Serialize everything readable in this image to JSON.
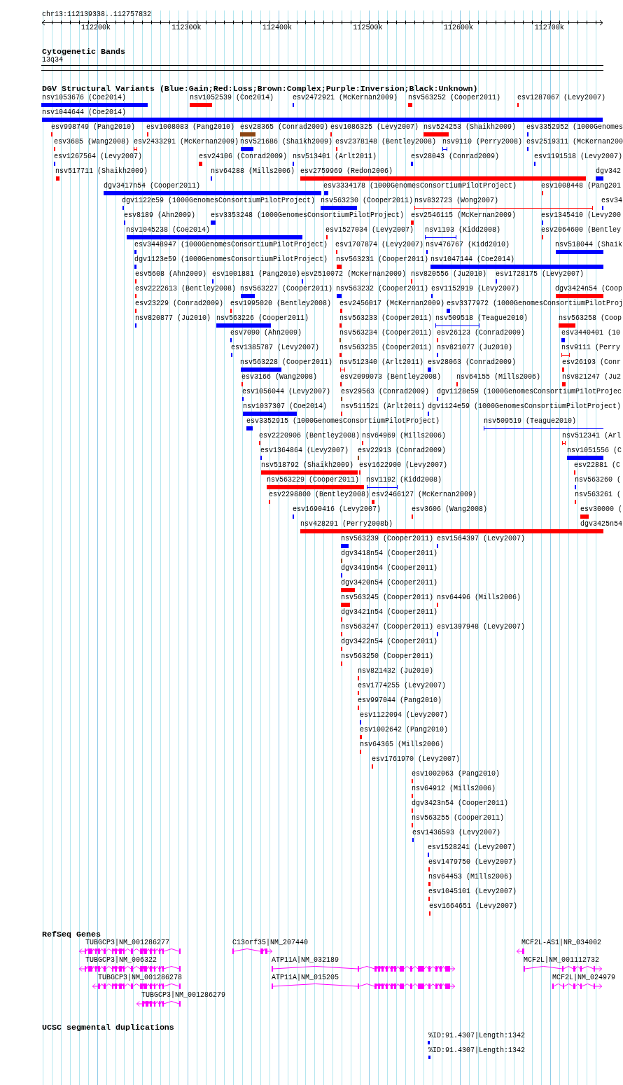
{
  "locus": "chr13:112139338..112757832",
  "ruler": {
    "ticks": [
      "112200k",
      "112300k",
      "112400k",
      "112500k",
      "112600k",
      "112700k"
    ]
  },
  "cytogenetic_bands": {
    "title": "Cytogenetic Bands",
    "bands": [
      {
        "label": "13q34"
      }
    ]
  },
  "dgv_variants": {
    "title": "DGV Structural Variants (Blue:Gain;Red:Loss;Brown:Complex;Purple:Inversion;Black:Unknown)",
    "rows": [
      {
        "features": [
          {
            "label": "nsv1053676 (Coe2014)",
            "kind": "bar",
            "color": "#0000ff"
          },
          {
            "label": "nsv1052539 (Coe2014)",
            "kind": "bar",
            "color": "#ff0000"
          },
          {
            "label": "esv2472921 (McKernan2009)",
            "kind": "bar",
            "color": "#0000ff"
          },
          {
            "label": "nsv563252 (Cooper2011)",
            "kind": "bar",
            "color": "#ff0000"
          },
          {
            "label": "esv1287067 (Levy2007)",
            "kind": "bar",
            "color": "#ff0000"
          }
        ]
      },
      {
        "features": [
          {
            "label": "nsv1044644 (Coe2014)",
            "kind": "bar",
            "color": "#0000ff"
          }
        ]
      },
      {
        "features": [
          {
            "label": "esv998749 (Pang2010)",
            "kind": "bar",
            "color": "#ff0000"
          },
          {
            "label": "esv1008083 (Pang2010)",
            "kind": "bar",
            "color": "#ff0000"
          },
          {
            "label": "esv28365 (Conrad2009)",
            "kind": "bar",
            "color": "#8b4513"
          },
          {
            "label": "esv1086325 (Levy2007)",
            "kind": "bar",
            "color": "#ff0000"
          },
          {
            "label": "nsv524253 (Shaikh2009)",
            "kind": "bar",
            "color": "#ff0000"
          },
          {
            "label": "esv3352952 (1000Genomes",
            "kind": "bar",
            "color": "#0000ff"
          }
        ]
      },
      {
        "features": [
          {
            "label": "esv3685 (Wang2008)",
            "kind": "bar",
            "color": "#ff0000"
          },
          {
            "label": "esv2433291 (McKernan2009)",
            "kind": "span",
            "color": "#ff0000"
          },
          {
            "label": "nsv521686 (Shaikh2009)",
            "kind": "bar",
            "color": "#0000ff"
          },
          {
            "label": "esv2378148 (Bentley2008)",
            "kind": "bar",
            "color": "#ff0000"
          },
          {
            "label": "nsv9110 (Perry2008)",
            "kind": "span",
            "color": "#0000ff"
          },
          {
            "label": "esv2519311 (McKernan200",
            "kind": "bar",
            "color": "#0000ff"
          }
        ]
      },
      {
        "features": [
          {
            "label": "esv1267564 (Levy2007)",
            "kind": "bar",
            "color": "#0000ff"
          },
          {
            "label": "esv24106 (Conrad2009)",
            "kind": "bar",
            "color": "#ff0000"
          },
          {
            "label": "nsv513401 (Arlt2011)",
            "kind": "bar",
            "color": "#0000ff"
          },
          {
            "label": "esv28043 (Conrad2009)",
            "kind": "bar",
            "color": "#0000ff"
          },
          {
            "label": "esv1191518 (Levy2007)",
            "kind": "bar",
            "color": "#0000ff"
          }
        ]
      },
      {
        "features": [
          {
            "label": "nsv517711 (Shaikh2009)",
            "kind": "bar",
            "color": "#ff0000"
          },
          {
            "label": "nsv64288 (Mills2006)",
            "kind": "bar",
            "color": "#0000ff"
          },
          {
            "label": "esv2759969 (Redon2006)",
            "kind": "bar",
            "color": "#ff0000"
          },
          {
            "label": "dgv342",
            "kind": "bar",
            "color": "#0000ff"
          }
        ]
      },
      {
        "features": [
          {
            "label": "dgv3417n54 (Cooper2011)",
            "kind": "bar",
            "color": "#0000ff"
          },
          {
            "label": "esv3334178 (1000GenomesConsortiumPilotProject)",
            "kind": "bar",
            "color": "#0000ff"
          },
          {
            "label": "esv1008448 (Pang201",
            "kind": "bar",
            "color": "#ff0000"
          }
        ]
      },
      {
        "features": [
          {
            "label": "dgv1122e59 (1000GenomesConsortiumPilotProject)",
            "kind": "bar",
            "color": "#0000ff"
          },
          {
            "label": "nsv563230 (Cooper2011)",
            "kind": "bar",
            "color": "#0000ff"
          },
          {
            "label": "nsv832723 (Wong2007)",
            "kind": "span",
            "color": "#ff0000"
          },
          {
            "label": "esv34",
            "kind": "bar",
            "color": "#0000ff"
          }
        ]
      },
      {
        "features": [
          {
            "label": "esv8189 (Ahn2009)",
            "kind": "bar",
            "color": "#0000ff"
          },
          {
            "label": "esv3353248 (1000GenomesConsortiumPilotProject)",
            "kind": "bar",
            "color": "#0000ff"
          },
          {
            "label": "esv2546115 (McKernan2009)",
            "kind": "bar",
            "color": "#ff0000"
          },
          {
            "label": "esv1345410 (Levy200",
            "kind": "bar",
            "color": "#0000ff"
          }
        ]
      },
      {
        "features": [
          {
            "label": "nsv1045238 (Coe2014)",
            "kind": "bar",
            "color": "#0000ff"
          },
          {
            "label": "esv1527034 (Levy2007)",
            "kind": "bar",
            "color": "#ff0000"
          },
          {
            "label": "nsv1193 (Kidd2008)",
            "kind": "span",
            "color": "#0000ff"
          },
          {
            "label": "esv2064600 (Bentley",
            "kind": "bar",
            "color": "#ff0000"
          }
        ]
      },
      {
        "features": [
          {
            "label": "esv3448947 (1000GenomesConsortiumPilotProject)",
            "kind": "bar",
            "color": "#0000ff"
          },
          {
            "label": "esv1707874 (Levy2007)",
            "kind": "bar",
            "color": "#ff0000"
          },
          {
            "label": "nsv476767 (Kidd2010)",
            "kind": "bar",
            "color": "#0000ff"
          },
          {
            "label": "nsv518044 (Shaik",
            "kind": "bar",
            "color": "#0000ff"
          }
        ]
      },
      {
        "features": [
          {
            "label": "dgv1123e59 (1000GenomesConsortiumPilotProject)",
            "kind": "bar",
            "color": "#0000ff"
          },
          {
            "label": "nsv563231 (Cooper2011)",
            "kind": "bar",
            "color": "#ff0000"
          },
          {
            "label": "nsv1047144 (Coe2014)",
            "kind": "bar",
            "color": "#0000ff"
          }
        ]
      },
      {
        "features": [
          {
            "label": "esv5608 (Ahn2009)",
            "kind": "bar",
            "color": "#ff0000"
          },
          {
            "label": "esv1001881 (Pang2010)",
            "kind": "bar",
            "color": "#0000ff"
          },
          {
            "label": "esv2510072 (McKernan2009)",
            "kind": "bar",
            "color": "#0000ff"
          },
          {
            "label": "nsv820556 (Ju2010)",
            "kind": "bar",
            "color": "#ff0000"
          },
          {
            "label": "esv1728175 (Levy2007)",
            "kind": "bar",
            "color": "#0000ff"
          }
        ]
      },
      {
        "features": [
          {
            "label": "esv2222613 (Bentley2008)",
            "kind": "bar",
            "color": "#ff0000"
          },
          {
            "label": "nsv563227 (Cooper2011)",
            "kind": "bar",
            "color": "#0000ff"
          },
          {
            "label": "nsv563232 (Cooper2011)",
            "kind": "bar",
            "color": "#0000ff"
          },
          {
            "label": "esv1152919 (Levy2007)",
            "kind": "bar",
            "color": "#0000ff"
          },
          {
            "label": "dgv3424n54 (Coop",
            "kind": "bar",
            "color": "#ff0000"
          }
        ]
      },
      {
        "features": [
          {
            "label": "esv23229 (Conrad2009)",
            "kind": "bar",
            "color": "#ff0000"
          },
          {
            "label": "esv1995020 (Bentley2008)",
            "kind": "bar",
            "color": "#ff0000"
          },
          {
            "label": "esv2456017 (McKernan2009)",
            "kind": "bar",
            "color": "#ff0000"
          },
          {
            "label": "esv3377972 (1000GenomesConsortiumPilotProj",
            "kind": "bar",
            "color": "#0000ff"
          }
        ]
      },
      {
        "features": [
          {
            "label": "nsv820877 (Ju2010)",
            "kind": "bar",
            "color": "#0000ff"
          },
          {
            "label": "nsv563226 (Cooper2011)",
            "kind": "bar",
            "color": "#0000ff"
          },
          {
            "label": "nsv563233 (Cooper2011)",
            "kind": "bar",
            "color": "#ff0000"
          },
          {
            "label": "nsv509518 (Teague2010)",
            "kind": "span",
            "color": "#0000ff"
          },
          {
            "label": "nsv563258 (Coop",
            "kind": "bar",
            "color": "#ff0000"
          }
        ]
      },
      {
        "features": [
          {
            "label": "esv7090 (Ahn2009)",
            "kind": "bar",
            "color": "#0000ff"
          },
          {
            "label": "nsv563234 (Cooper2011)",
            "kind": "bar",
            "color": "#8b4513"
          },
          {
            "label": "esv26123 (Conrad2009)",
            "kind": "bar",
            "color": "#ff0000"
          },
          {
            "label": "esv3440401 (10",
            "kind": "bar",
            "color": "#0000ff"
          }
        ]
      },
      {
        "features": [
          {
            "label": "esv1385787 (Levy2007)",
            "kind": "bar",
            "color": "#0000ff"
          },
          {
            "label": "nsv563235 (Cooper2011)",
            "kind": "bar",
            "color": "#ff0000"
          },
          {
            "label": "nsv821077 (Ju2010)",
            "kind": "bar",
            "color": "#0000ff"
          },
          {
            "label": "nsv9111 (Perry",
            "kind": "span",
            "color": "#ff0000"
          }
        ]
      },
      {
        "features": [
          {
            "label": "nsv563228 (Cooper2011)",
            "kind": "bar",
            "color": "#0000ff"
          },
          {
            "label": "nsv512340 (Arlt2011)",
            "kind": "span",
            "color": "#ff0000"
          },
          {
            "label": "esv28063 (Conrad2009)",
            "kind": "bar",
            "color": "#0000ff"
          },
          {
            "label": "esv26193 (Conr",
            "kind": "bar",
            "color": "#ff0000"
          }
        ]
      },
      {
        "features": [
          {
            "label": "esv3166 (Wang2008)",
            "kind": "bar",
            "color": "#ff0000"
          },
          {
            "label": "esv2099073 (Bentley2008)",
            "kind": "bar",
            "color": "#ff0000"
          },
          {
            "label": "nsv64155 (Mills2006)",
            "kind": "bar",
            "color": "#ff0000"
          },
          {
            "label": "nsv821247 (Ju2",
            "kind": "bar",
            "color": "#ff0000"
          }
        ]
      },
      {
        "features": [
          {
            "label": "esv1056044 (Levy2007)",
            "kind": "bar",
            "color": "#0000ff"
          },
          {
            "label": "esv29563 (Conrad2009)",
            "kind": "bar",
            "color": "#8b4513"
          },
          {
            "label": "dgv1128e59 (1000GenomesConsortiumPilotProjec",
            "kind": "bar",
            "color": "#0000ff"
          }
        ]
      },
      {
        "features": [
          {
            "label": "nsv1037307 (Coe2014)",
            "kind": "bar",
            "color": "#0000ff"
          },
          {
            "label": "nsv511521 (Arlt2011)",
            "kind": "bar",
            "color": "#ff0000"
          },
          {
            "label": "dgv1124e59 (1000GenomesConsortiumPilotProject)",
            "kind": "bar",
            "color": "#0000ff"
          }
        ]
      },
      {
        "features": [
          {
            "label": "esv3352915 (1000GenomesConsortiumPilotProject)",
            "kind": "bar",
            "color": "#0000ff"
          },
          {
            "label": "nsv509519 (Teague2010)",
            "kind": "span",
            "color": "#0000ff"
          }
        ]
      },
      {
        "features": [
          {
            "label": "esv2220906 (Bentley2008)",
            "kind": "bar",
            "color": "#ff0000"
          },
          {
            "label": "nsv64969 (Mills2006)",
            "kind": "bar",
            "color": "#ff0000"
          },
          {
            "label": "nsv512341 (Arl",
            "kind": "span",
            "color": "#ff0000"
          }
        ]
      },
      {
        "features": [
          {
            "label": "esv1364864 (Levy2007)",
            "kind": "bar",
            "color": "#0000ff"
          },
          {
            "label": "esv22913 (Conrad2009)",
            "kind": "bar",
            "color": "#8b4513"
          },
          {
            "label": "nsv1051556 (C",
            "kind": "bar",
            "color": "#0000ff"
          }
        ]
      },
      {
        "features": [
          {
            "label": "nsv518792 (Shaikh2009)",
            "kind": "bar",
            "color": "#ff0000"
          },
          {
            "label": "esv1622900 (Levy2007)",
            "kind": "bar",
            "color": "#ff0000"
          },
          {
            "label": "esv22881 (C",
            "kind": "bar",
            "color": "#ff0000"
          }
        ]
      },
      {
        "features": [
          {
            "label": "nsv563229 (Cooper2011)",
            "kind": "bar",
            "color": "#ff0000"
          },
          {
            "label": "nsv1192 (Kidd2008)",
            "kind": "span",
            "color": "#0000ff"
          },
          {
            "label": "nsv563260 (",
            "kind": "bar",
            "color": "#0000ff"
          }
        ]
      },
      {
        "features": [
          {
            "label": "esv2298800 (Bentley2008)",
            "kind": "bar",
            "color": "#ff0000"
          },
          {
            "label": "esv2466127 (McKernan2009)",
            "kind": "bar",
            "color": "#ff0000"
          },
          {
            "label": "nsv563261 (",
            "kind": "bar",
            "color": "#ff0000"
          }
        ]
      },
      {
        "features": [
          {
            "label": "esv1690416 (Levy2007)",
            "kind": "bar",
            "color": "#0000ff"
          },
          {
            "label": "esv3606 (Wang2008)",
            "kind": "bar",
            "color": "#ff0000"
          },
          {
            "label": "esv30000 (",
            "kind": "bar",
            "color": "#ff0000"
          }
        ]
      },
      {
        "features": [
          {
            "label": "nsv428291 (Perry2008b)",
            "kind": "bar",
            "color": "#ff0000"
          },
          {
            "label": "dgv3425n54",
            "kind": "bar",
            "color": "#ff0000"
          }
        ]
      },
      {
        "features": [
          {
            "label": "nsv563239 (Cooper2011)",
            "kind": "bar",
            "color": "#0000ff"
          },
          {
            "label": "esv1564397 (Levy2007)",
            "kind": "bar",
            "color": "#0000ff"
          }
        ]
      },
      {
        "features": [
          {
            "label": "dgv3418n54 (Cooper2011)",
            "kind": "bar",
            "color": "#8b4513"
          }
        ]
      },
      {
        "features": [
          {
            "label": "dgv3419n54 (Cooper2011)",
            "kind": "bar",
            "color": "#0000ff"
          }
        ]
      },
      {
        "features": [
          {
            "label": "dgv3420n54 (Cooper2011)",
            "kind": "bar",
            "color": "#ff0000"
          }
        ]
      },
      {
        "features": [
          {
            "label": "nsv563245 (Cooper2011)",
            "kind": "bar",
            "color": "#ff0000"
          },
          {
            "label": "nsv64496 (Mills2006)",
            "kind": "bar",
            "color": "#ff0000"
          }
        ]
      },
      {
        "features": [
          {
            "label": "dgv3421n54 (Cooper2011)",
            "kind": "bar",
            "color": "#ff0000"
          }
        ]
      },
      {
        "features": [
          {
            "label": "nsv563247 (Cooper2011)",
            "kind": "bar",
            "color": "#ff0000"
          },
          {
            "label": "esv1397948 (Levy2007)",
            "kind": "bar",
            "color": "#0000ff"
          }
        ]
      },
      {
        "features": [
          {
            "label": "dgv3422n54 (Cooper2011)",
            "kind": "bar",
            "color": "#ff0000"
          }
        ]
      },
      {
        "features": [
          {
            "label": "nsv563250 (Cooper2011)",
            "kind": "bar",
            "color": "#ff0000"
          }
        ]
      },
      {
        "features": [
          {
            "label": "nsv821432 (Ju2010)",
            "kind": "bar",
            "color": "#ff0000"
          }
        ]
      },
      {
        "features": [
          {
            "label": "esv1774255 (Levy2007)",
            "kind": "bar",
            "color": "#ff0000"
          }
        ]
      },
      {
        "features": [
          {
            "label": "esv997044 (Pang2010)",
            "kind": "bar",
            "color": "#ff0000"
          }
        ]
      },
      {
        "features": [
          {
            "label": "esv1122094 (Levy2007)",
            "kind": "bar",
            "color": "#0000ff"
          }
        ]
      },
      {
        "features": [
          {
            "label": "esv1002642 (Pang2010)",
            "kind": "bar",
            "color": "#ff0000"
          }
        ]
      },
      {
        "features": [
          {
            "label": "nsv64365 (Mills2006)",
            "kind": "bar",
            "color": "#ff0000"
          }
        ]
      },
      {
        "features": [
          {
            "label": "esv1761970 (Levy2007)",
            "kind": "bar",
            "color": "#ff0000"
          }
        ]
      },
      {
        "features": [
          {
            "label": "esv1002063 (Pang2010)",
            "kind": "bar",
            "color": "#ff0000"
          }
        ]
      },
      {
        "features": [
          {
            "label": "nsv64912 (Mills2006)",
            "kind": "bar",
            "color": "#ff0000"
          }
        ]
      },
      {
        "features": [
          {
            "label": "dgv3423n54 (Cooper2011)",
            "kind": "bar",
            "color": "#ff0000"
          }
        ]
      },
      {
        "features": [
          {
            "label": "nsv563255 (Cooper2011)",
            "kind": "bar",
            "color": "#ff0000"
          }
        ]
      },
      {
        "features": [
          {
            "label": "esv1436593 (Levy2007)",
            "kind": "bar",
            "color": "#0000ff"
          }
        ]
      },
      {
        "features": [
          {
            "label": "esv1528241 (Levy2007)",
            "kind": "bar",
            "color": "#0000ff"
          }
        ]
      },
      {
        "features": [
          {
            "label": "esv1479750 (Levy2007)",
            "kind": "bar",
            "color": "#ff0000"
          }
        ]
      },
      {
        "features": [
          {
            "label": "nsv64453 (Mills2006)",
            "kind": "bar",
            "color": "#ff0000"
          }
        ]
      },
      {
        "features": [
          {
            "label": "esv1045101 (Levy2007)",
            "kind": "bar",
            "color": "#ff0000"
          }
        ]
      },
      {
        "features": [
          {
            "label": "esv1664651 (Levy2007)",
            "kind": "bar",
            "color": "#ff0000"
          }
        ]
      }
    ]
  },
  "refseq_genes": {
    "title": "RefSeq Genes",
    "rows": [
      {
        "genes": [
          {
            "label": "TUBGCP3|NM_001286277",
            "minus_strand": true
          },
          {
            "label": "C13orf35|NM_207440",
            "minus_strand": false
          },
          {
            "label": "MCF2L-AS1|NR_034002",
            "minus_strand": true
          }
        ]
      },
      {
        "genes": [
          {
            "label": "TUBGCP3|NM_006322",
            "minus_strand": true
          },
          {
            "label": "ATP11A|NM_032189",
            "minus_strand": false
          },
          {
            "label": "MCF2L|NM_001112732",
            "minus_strand": false
          }
        ]
      },
      {
        "genes": [
          {
            "label": "TUBGCP3|NM_001286278",
            "minus_strand": true
          },
          {
            "label": "ATP11A|NM_015205",
            "minus_strand": false
          },
          {
            "label": "MCF2L|NM_024979",
            "minus_strand": false
          }
        ]
      },
      {
        "genes": [
          {
            "label": "TUBGCP3|NM_001286279",
            "minus_strand": true
          }
        ]
      }
    ]
  },
  "segmental_duplications": {
    "title": "UCSC segmental duplications",
    "features": [
      {
        "label": "%ID:91.4307|Length:1342"
      },
      {
        "label": "%ID:91.4307|Length:1342"
      }
    ]
  }
}
